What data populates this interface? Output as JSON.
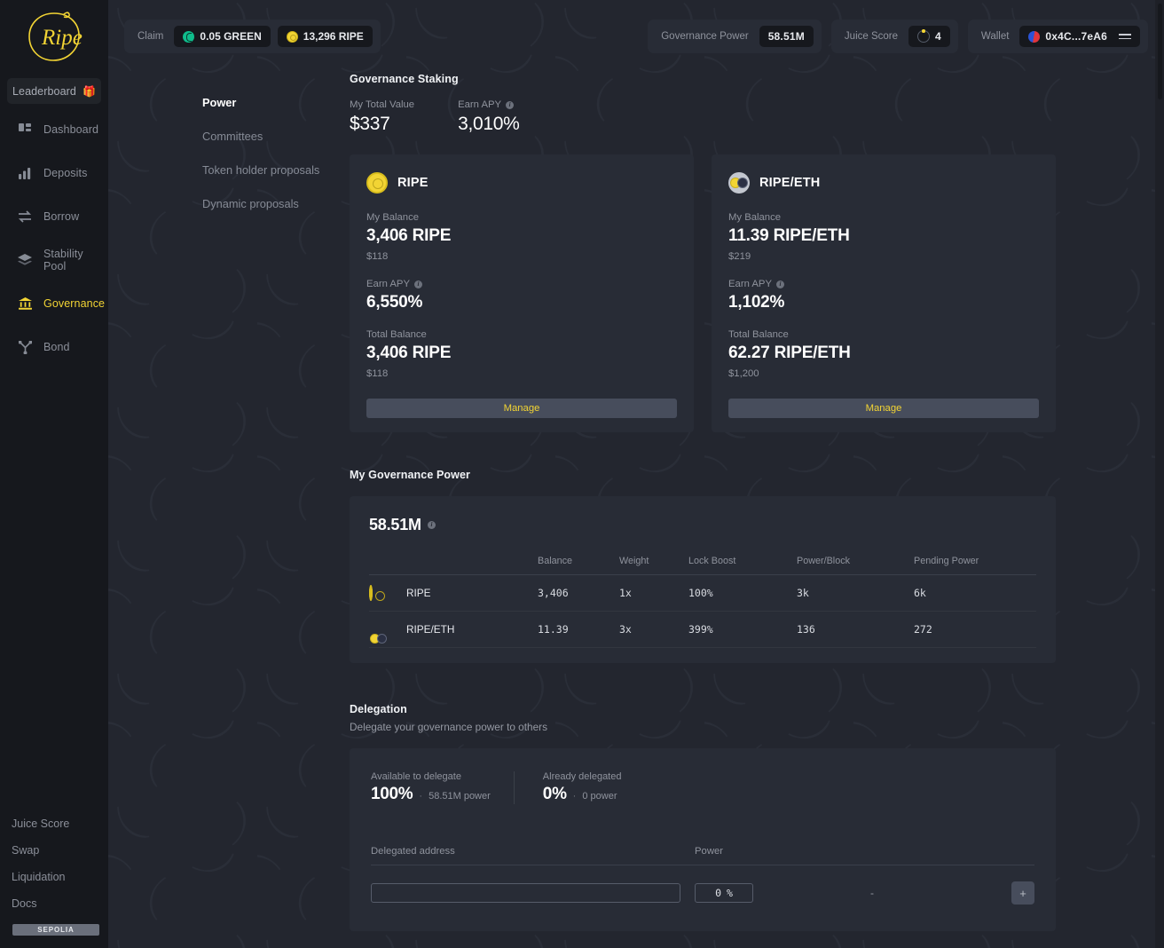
{
  "brand": {
    "logo_text": "Ripe"
  },
  "sidebar": {
    "leaderboard": {
      "label": "Leaderboard",
      "icon": "gift-icon"
    },
    "items": [
      {
        "label": "Dashboard",
        "icon": "dashboard-icon",
        "active": false
      },
      {
        "label": "Deposits",
        "icon": "bar-chart-icon",
        "active": false
      },
      {
        "label": "Borrow",
        "icon": "swap-arrows-icon",
        "active": false
      },
      {
        "label": "Stability Pool",
        "icon": "layers-icon",
        "active": false
      },
      {
        "label": "Governance",
        "icon": "bank-icon",
        "active": true
      },
      {
        "label": "Bond",
        "icon": "bond-icon",
        "active": false
      }
    ],
    "links": [
      "Juice Score",
      "Swap",
      "Liquidation",
      "Docs"
    ],
    "network_badge": "SEPOLIA"
  },
  "topbar": {
    "claim_label": "Claim",
    "claim_items": [
      {
        "icon": "green-token-icon",
        "value": "0.05 GREEN"
      },
      {
        "icon": "ripe-token-icon",
        "value": "13,296 RIPE"
      }
    ],
    "governance_power": {
      "label": "Governance Power",
      "value": "58.51M"
    },
    "juice_score": {
      "label": "Juice Score",
      "value": "4",
      "icon": "progress-ring-icon"
    },
    "wallet": {
      "label": "Wallet",
      "address": "0x4C...7eA6",
      "icon": "wallet-avatar-icon",
      "menu_icon": "menu-icon"
    }
  },
  "subnav": {
    "items": [
      {
        "label": "Power",
        "active": true
      },
      {
        "label": "Committees",
        "active": false
      },
      {
        "label": "Token holder proposals",
        "active": false
      },
      {
        "label": "Dynamic proposals",
        "active": false
      }
    ]
  },
  "staking": {
    "title": "Governance Staking",
    "total_value": {
      "label": "My Total Value",
      "value": "$337"
    },
    "earn_apy": {
      "label": "Earn APY",
      "value": "3,010%"
    },
    "cards": [
      {
        "icon": "ripe-token-icon",
        "name": "RIPE",
        "my_balance_label": "My Balance",
        "my_balance": "3,406 RIPE",
        "my_balance_usd": "$118",
        "apy_label": "Earn APY",
        "apy": "6,550%",
        "total_label": "Total Balance",
        "total": "3,406 RIPE",
        "total_usd": "$118",
        "manage_label": "Manage"
      },
      {
        "icon": "ripe-eth-pair-icon",
        "name": "RIPE/ETH",
        "my_balance_label": "My Balance",
        "my_balance": "11.39 RIPE/ETH",
        "my_balance_usd": "$219",
        "apy_label": "Earn APY",
        "apy": "1,102%",
        "total_label": "Total Balance",
        "total": "62.27 RIPE/ETH",
        "total_usd": "$1,200",
        "manage_label": "Manage"
      }
    ]
  },
  "governance_power": {
    "title": "My Governance Power",
    "total": "58.51M",
    "columns": [
      "",
      "",
      "Balance",
      "Weight",
      "Lock Boost",
      "Power/Block",
      "Pending Power"
    ],
    "rows": [
      {
        "icon": "ripe-token-icon",
        "name": "RIPE",
        "balance": "3,406",
        "weight": "1x",
        "lock_boost": "100%",
        "power_block": "3k",
        "pending_power": "6k"
      },
      {
        "icon": "ripe-eth-pair-icon",
        "name": "RIPE/ETH",
        "balance": "11.39",
        "weight": "3x",
        "lock_boost": "399%",
        "power_block": "136",
        "pending_power": "272"
      }
    ]
  },
  "delegation": {
    "title": "Delegation",
    "subtitle": "Delegate your governance power to others",
    "available": {
      "label": "Available to delegate",
      "pct": "100%",
      "note": "58.51M power"
    },
    "delegated": {
      "label": "Already delegated",
      "pct": "0%",
      "note": "0 power"
    },
    "address_col": "Delegated address",
    "power_col": "Power",
    "address_value": "",
    "address_placeholder": "",
    "power_value": "0",
    "power_unit": "%",
    "result_value": "-",
    "add_label": "+"
  },
  "colors": {
    "accent": "#f2d434",
    "bg": "#23262f",
    "card": "#282c36",
    "sidebar": "#16181d",
    "button": "#474d5c",
    "muted": "#8f939d"
  }
}
